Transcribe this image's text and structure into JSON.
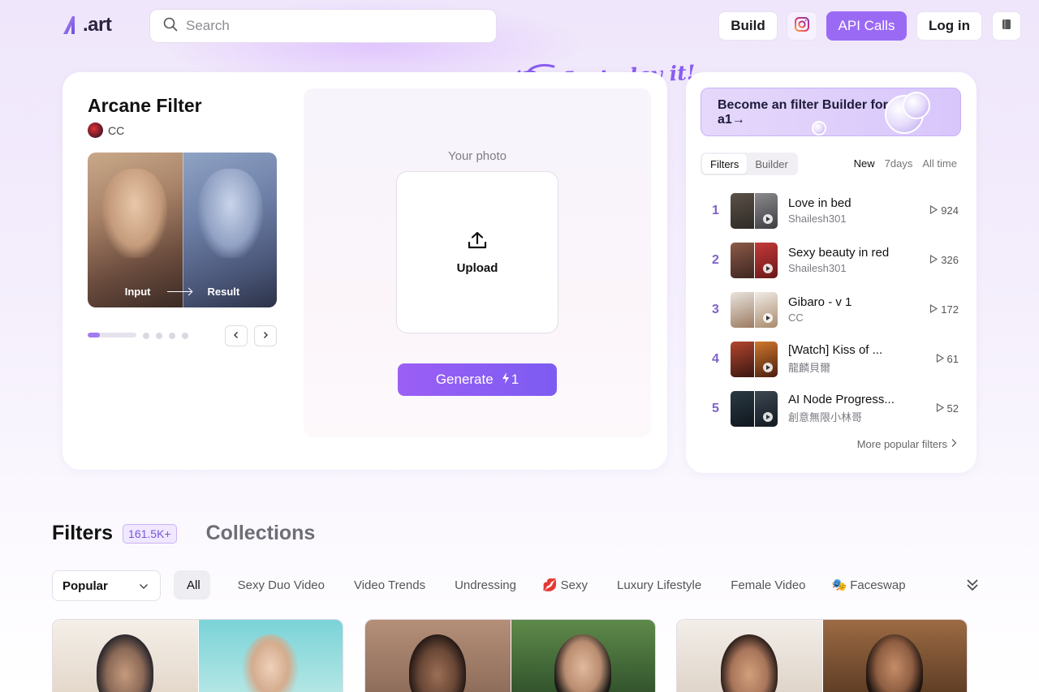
{
  "header": {
    "logo_text": ".art",
    "search_placeholder": "Search",
    "build_label": "Build",
    "api_label": "API Calls",
    "login_label": "Log in"
  },
  "hero": {
    "filter_title": "Arcane Filter",
    "author": "CC",
    "preview_input_label": "Input",
    "preview_result_label": "Result",
    "slide_progress": 0.25,
    "your_photo_label": "Your photo",
    "upload_label": "Upload",
    "generate_label": "Generate",
    "generate_cost": "1",
    "tagline": "Just play it!"
  },
  "sidebar": {
    "banner_text": "Become an filter Builder for a1→",
    "seg_tabs": [
      "Filters",
      "Builder"
    ],
    "time_tabs": [
      "New",
      "7days",
      "All time"
    ],
    "ranking": [
      {
        "rank": "1",
        "title": "Love in bed",
        "author": "Shailesh301",
        "count": "924"
      },
      {
        "rank": "2",
        "title": "Sexy beauty in red",
        "author": "Shailesh301",
        "count": "326"
      },
      {
        "rank": "3",
        "title": "Gibaro - v 1",
        "author": "CC",
        "count": "172"
      },
      {
        "rank": "4",
        "title": "[Watch] Kiss of ...",
        "author": "龍麟貝爾",
        "count": "61"
      },
      {
        "rank": "5",
        "title": "AI Node Progress...",
        "author": "創意無限小林哥",
        "count": "52"
      }
    ],
    "more_label": "More popular filters"
  },
  "filters": {
    "title": "Filters",
    "count_badge": "161.5K+",
    "collections_label": "Collections",
    "sort_value": "Popular",
    "categories": [
      {
        "label": "All",
        "emoji": ""
      },
      {
        "label": "Sexy Duo Video",
        "emoji": ""
      },
      {
        "label": "Video Trends",
        "emoji": ""
      },
      {
        "label": "Undressing",
        "emoji": ""
      },
      {
        "label": "Sexy",
        "emoji": "💋"
      },
      {
        "label": "Luxury Lifestyle",
        "emoji": ""
      },
      {
        "label": "Female Video",
        "emoji": ""
      },
      {
        "label": "Faceswap",
        "emoji": "🎭"
      }
    ]
  },
  "colors": {
    "accent": "#9b6af5",
    "rank_number": "#7e63c7"
  }
}
